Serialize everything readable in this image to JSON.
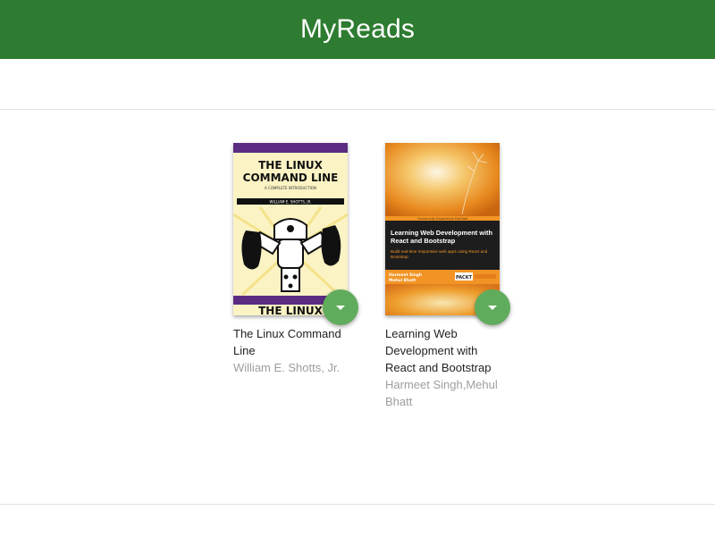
{
  "header": {
    "title": "MyReads"
  },
  "books": [
    {
      "title": "The Linux Command Line",
      "authors": "William E. Shotts, Jr.",
      "cover": {
        "title_line1": "THE LINUX",
        "title_line2": "COMMAND LINE",
        "subtitle": "A COMPLETE INTRODUCTION",
        "author": "WILLIAM E. SHOTTS, JR.",
        "bottom_text": "THE LINUX"
      }
    },
    {
      "title": "Learning Web Development with React and Bootstrap",
      "authors": "Harmeet Singh,Mehul Bhatt",
      "cover": {
        "banner": "Community Experience Distilled",
        "title": "Learning Web Development with React and Bootstrap",
        "subtitle": "Build real-time responsive web apps using React and Bootstrap",
        "author_line1": "Harmeet Singh",
        "author_line2": "Mehul Bhatt",
        "publisher": "PACKT"
      }
    }
  ],
  "colors": {
    "header_bg": "#2e7c31",
    "fab_bg": "#60ac5d",
    "author_text": "#9e9e9e"
  }
}
